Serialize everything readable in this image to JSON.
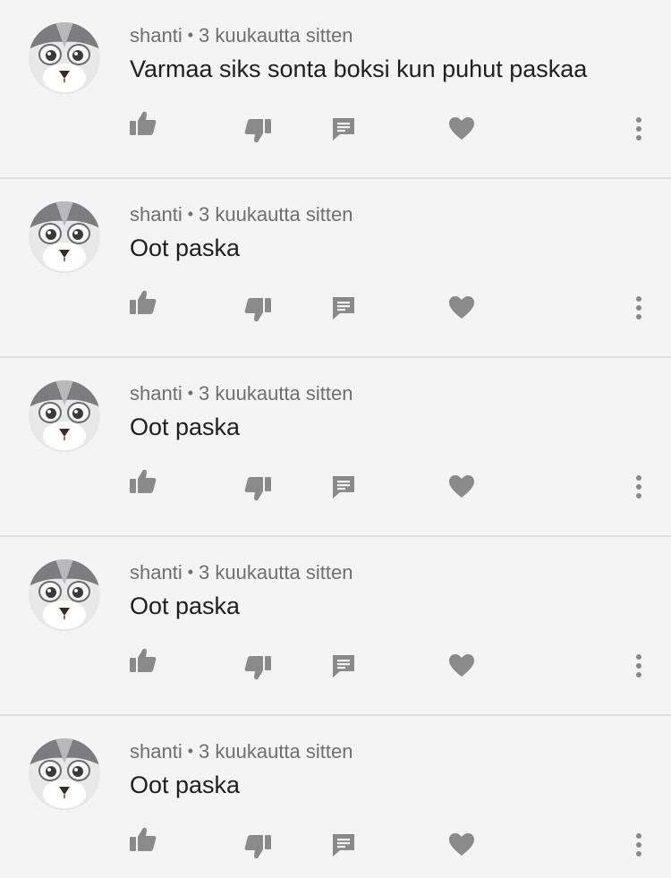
{
  "comments": [
    {
      "author": "shanti",
      "time": "3 kuukautta sitten",
      "text": "Varmaa siks sonta boksi kun puhut paskaa"
    },
    {
      "author": "shanti",
      "time": "3 kuukautta sitten",
      "text": "Oot paska"
    },
    {
      "author": "shanti",
      "time": "3 kuukautta sitten",
      "text": "Oot paska"
    },
    {
      "author": "shanti",
      "time": "3 kuukautta sitten",
      "text": "Oot paska"
    },
    {
      "author": "shanti",
      "time": "3 kuukautta sitten",
      "text": "Oot paska"
    }
  ],
  "separator": "•",
  "icons": {
    "like": "thumbs-up-icon",
    "dislike": "thumbs-down-icon",
    "reply": "comment-icon",
    "heart": "heart-icon",
    "more": "more-vertical-icon"
  },
  "colors": {
    "background": "#f4f4f4",
    "icon": "#8a8a8a",
    "meta_text": "#6f6f6f",
    "body_text": "#1f1f1f",
    "divider": "#dedede"
  }
}
